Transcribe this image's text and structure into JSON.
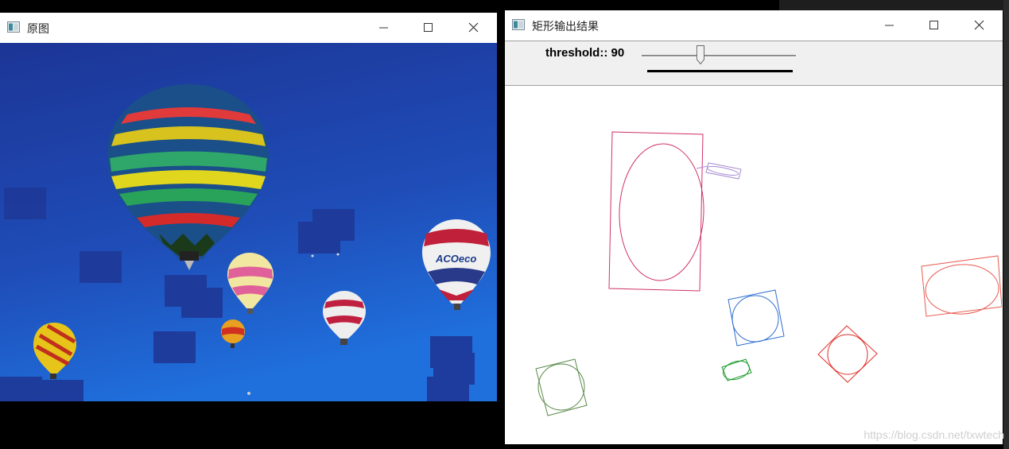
{
  "window_left": {
    "title": "原图",
    "icon": "opencv-window-icon"
  },
  "window_right": {
    "title": "矩形输出结果",
    "icon": "opencv-window-icon",
    "trackbar": {
      "label": "threshold:: 90",
      "value": 90
    }
  },
  "background": {
    "watermark": "https://blog.csdn.net/txwtech"
  },
  "colors": {
    "sky_top": "#1f3a9e",
    "sky_bottom": "#1e6bd8",
    "rect_magenta": "#d0306a",
    "rect_lavender": "#a68ad0",
    "rect_blue": "#2f6fd0",
    "rect_red": "#e0302a",
    "rect_green": "#1a9a2a",
    "rect_olive": "#5a8a4a",
    "rect_salmon": "#e85a50"
  }
}
